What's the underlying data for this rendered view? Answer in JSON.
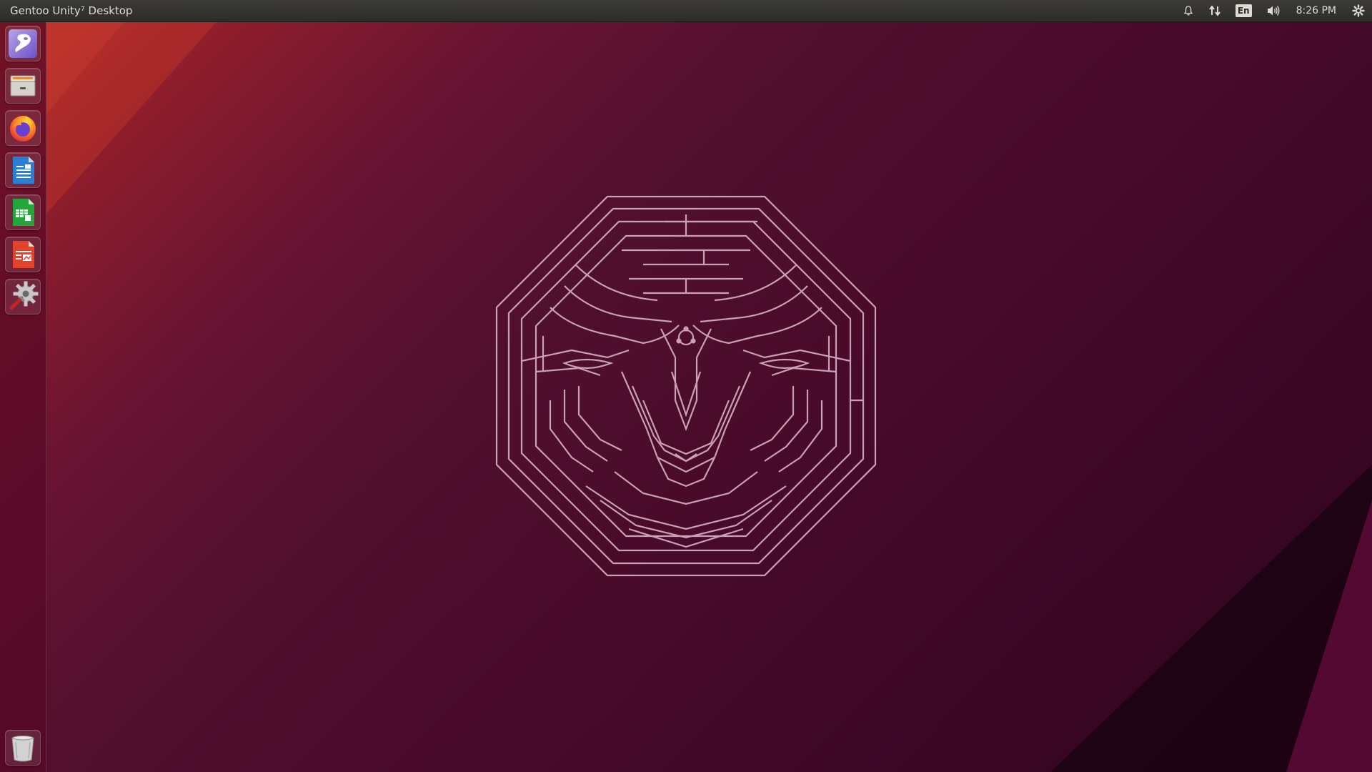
{
  "top_panel": {
    "title": "Gentoo Unity⁷ Desktop",
    "indicators": [
      {
        "name": "notification-bell-icon"
      },
      {
        "name": "network-arrows-icon"
      },
      {
        "name": "keyboard-layout",
        "label": "En"
      },
      {
        "name": "volume-icon"
      },
      {
        "name": "clock",
        "label": "8:26 PM"
      },
      {
        "name": "session-gear-icon"
      }
    ],
    "keyboard_label": "En",
    "clock": "8:26 PM"
  },
  "launcher": {
    "items": [
      {
        "name": "launcher-item-gentoo",
        "icon": "gentoo-logo-icon"
      },
      {
        "name": "launcher-item-file-manager",
        "icon": "file-cabinet-icon"
      },
      {
        "name": "launcher-item-firefox",
        "icon": "firefox-icon"
      },
      {
        "name": "launcher-item-writer",
        "icon": "libreoffice-writer-icon"
      },
      {
        "name": "launcher-item-calc",
        "icon": "libreoffice-calc-icon"
      },
      {
        "name": "launcher-item-impress",
        "icon": "libreoffice-impress-icon"
      },
      {
        "name": "launcher-item-settings",
        "icon": "system-settings-icon"
      }
    ],
    "trash": {
      "name": "launcher-item-trash",
      "icon": "trash-icon"
    }
  },
  "wallpaper": {
    "emblem": "maze-bull-head-icon",
    "colors": {
      "primary": "#4a0a2a",
      "accent": "#c0342a",
      "line": "#c9a0b6"
    }
  }
}
